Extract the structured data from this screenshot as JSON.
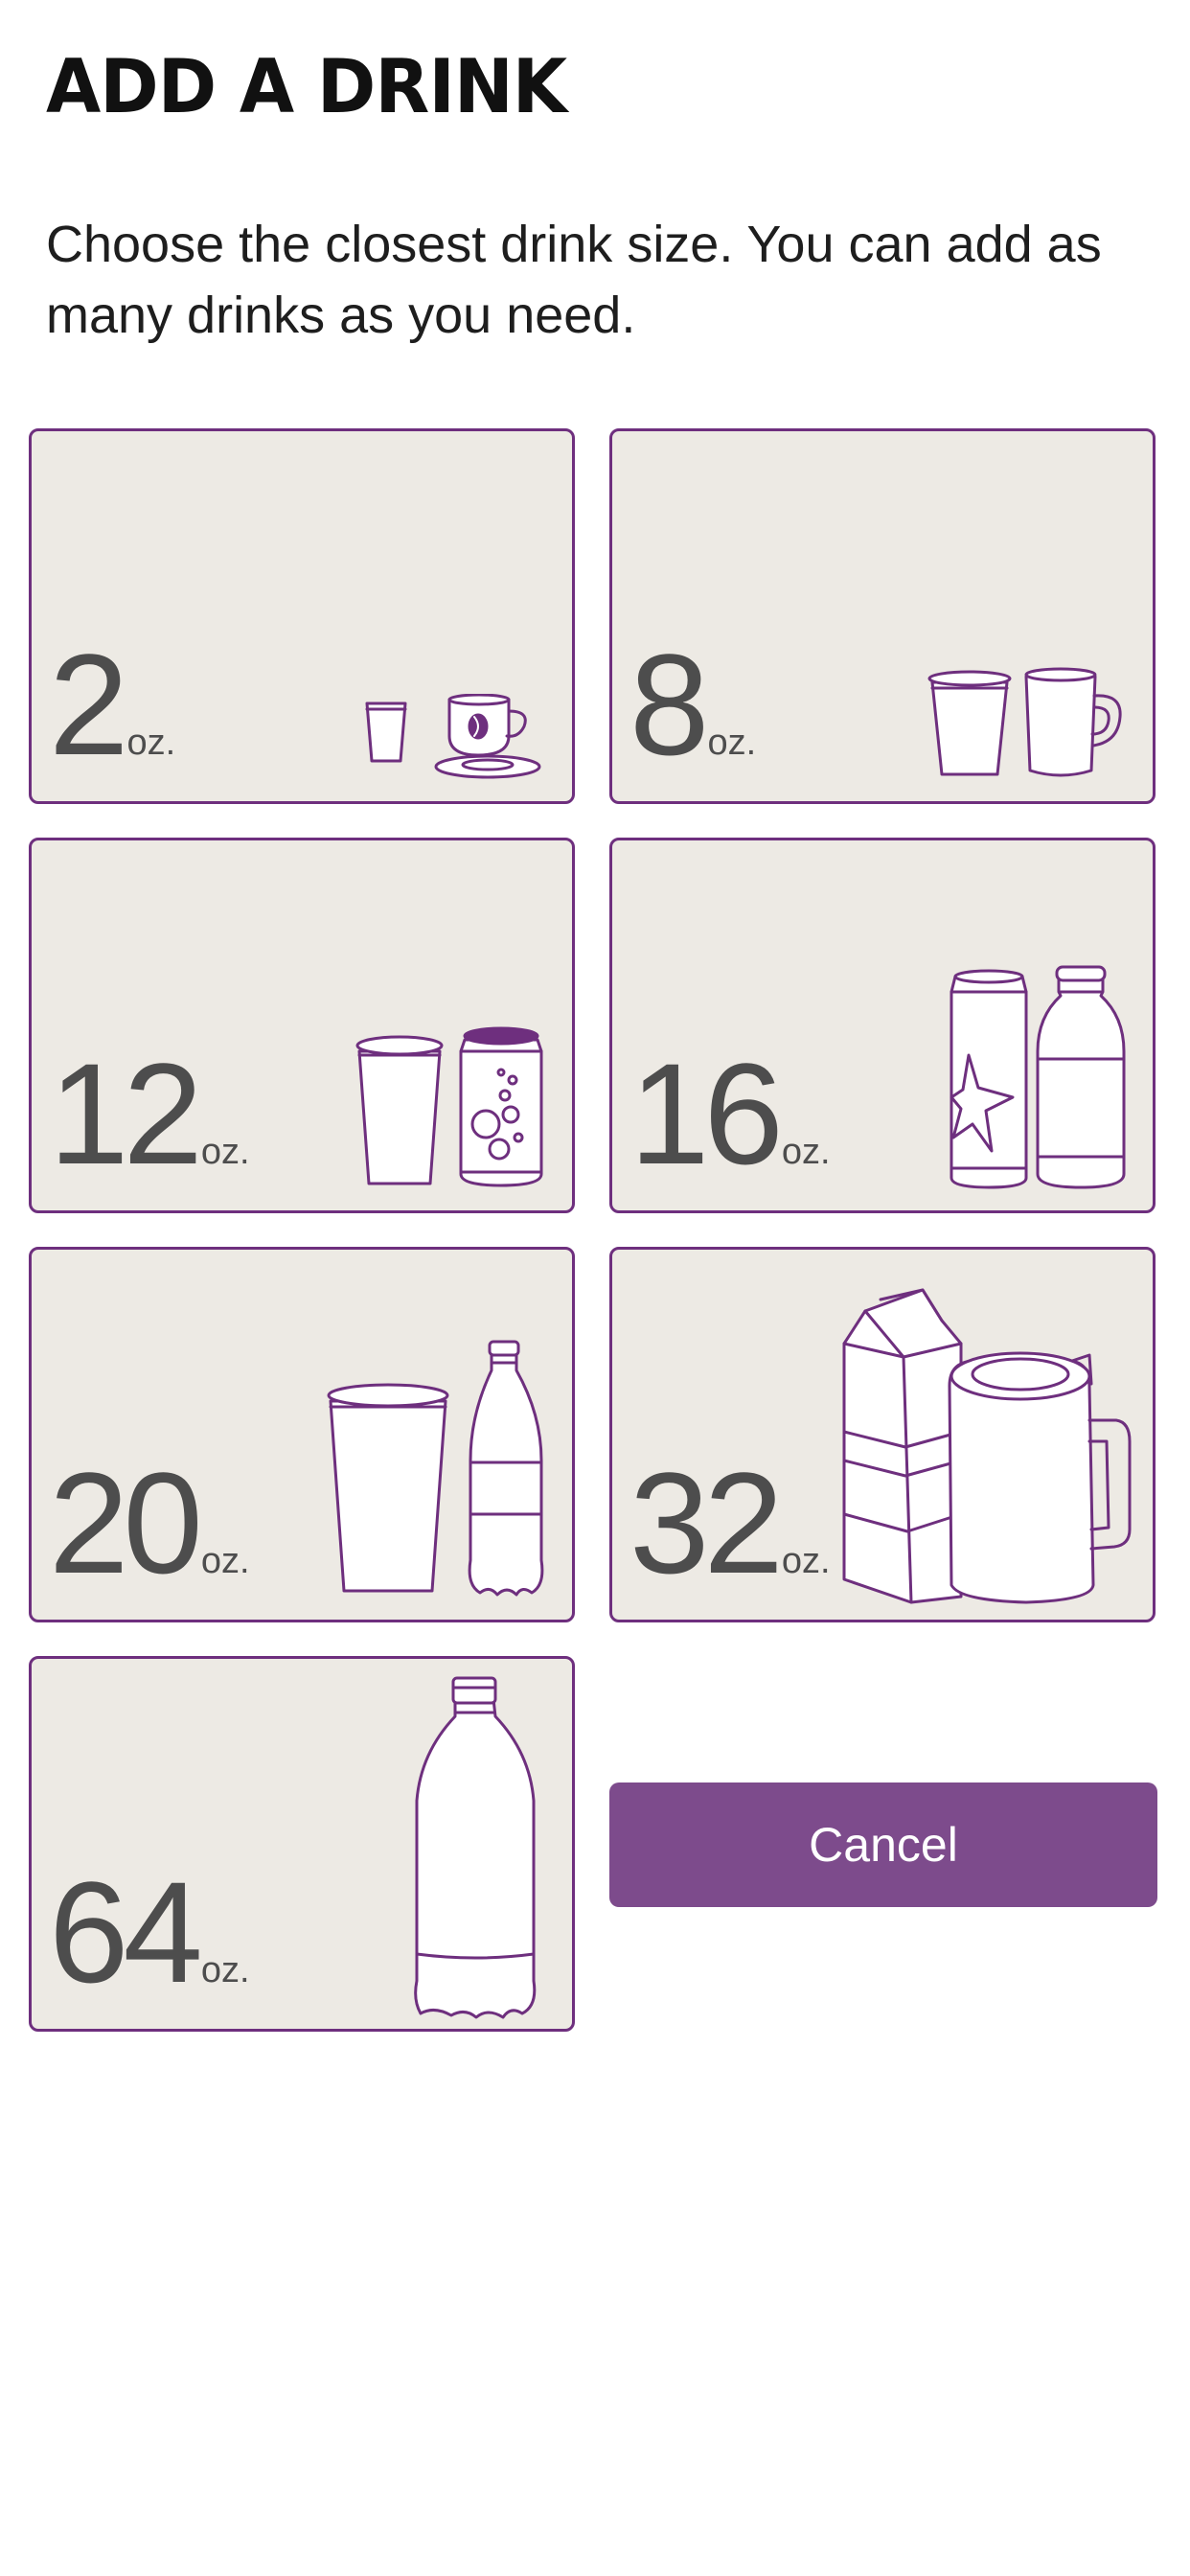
{
  "header": {
    "title": "ADD A DRINK",
    "subtitle": "Choose the closest drink size. You can add as many drinks as you need."
  },
  "options": [
    {
      "value": "2",
      "unit": "oz.",
      "icons": [
        "shot-glass-icon",
        "espresso-cup-icon"
      ]
    },
    {
      "value": "8",
      "unit": "oz.",
      "icons": [
        "small-cup-icon",
        "coffee-mug-icon"
      ]
    },
    {
      "value": "12",
      "unit": "oz.",
      "icons": [
        "cup-icon",
        "soda-can-icon"
      ]
    },
    {
      "value": "16",
      "unit": "oz.",
      "icons": [
        "tall-can-icon",
        "milk-bottle-icon"
      ]
    },
    {
      "value": "20",
      "unit": "oz.",
      "icons": [
        "large-cup-icon",
        "soda-bottle-icon"
      ]
    },
    {
      "value": "32",
      "unit": "oz.",
      "icons": [
        "milk-carton-icon",
        "travel-mug-icon"
      ]
    },
    {
      "value": "64",
      "unit": "oz.",
      "icons": [
        "large-bottle-icon"
      ]
    }
  ],
  "actions": {
    "cancel_label": "Cancel"
  },
  "colors": {
    "accent": "#7d4b8c",
    "card_border": "#6e2f7e",
    "card_background": "#edeae4",
    "icon_stroke": "#6e2f7e"
  }
}
